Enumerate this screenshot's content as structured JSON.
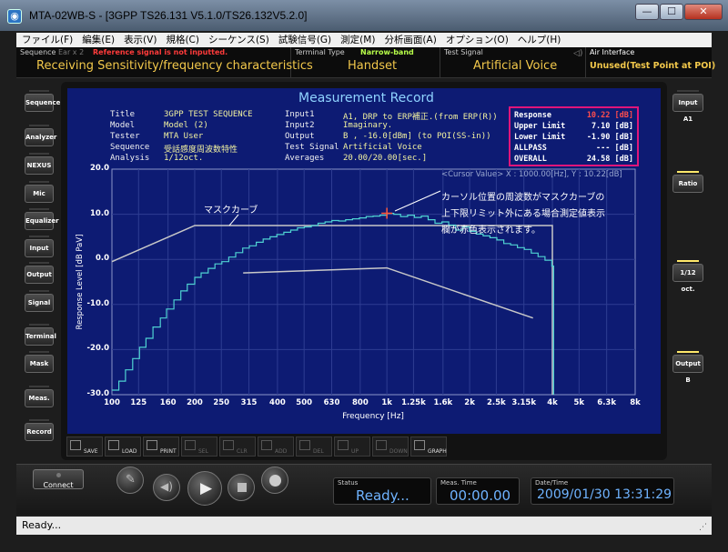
{
  "window": {
    "title": "MTA-02WB-S - [3GPP TS26.131 V5.1.0/TS26.132V5.2.0]"
  },
  "menu": [
    "ファイル(F)",
    "編集(E)",
    "表示(V)",
    "規格(C)",
    "シーケンス(S)",
    "試験信号(G)",
    "測定(M)",
    "分析画面(A)",
    "オプション(O)",
    "ヘルプ(H)"
  ],
  "infobar": {
    "sequence_label": "Sequence",
    "ear_label": "Ear x 2",
    "warning": "Reference signal is not inputted.",
    "sequence_value": "Receiving Sensitivity/frequency characteristics",
    "terminal_label": "Terminal Type",
    "narrowband": "Narrow-band",
    "terminal_value": "Handset",
    "signal_label": "Test Signal",
    "signal_value": "Artificial Voice",
    "air_label": "Air Interface",
    "air_value": "Unused(Test Point at POI)"
  },
  "left_buttons": [
    "Sequence",
    "Analyzer",
    "NEXUS",
    "Mic",
    "Equalizer",
    "Input",
    "Output",
    "Signal",
    "Terminal",
    "Mask",
    "Meas.",
    "Record"
  ],
  "right_buttons": [
    {
      "label": "Input A1",
      "lit": false
    },
    {
      "label": "Ratio",
      "lit": true
    },
    {
      "label": "1/12 oct.",
      "lit": true
    },
    {
      "label": "Output B",
      "lit": true
    }
  ],
  "record": {
    "title": "Measurement Record",
    "rows": [
      {
        "k1": "Title",
        "v1": "3GPP TEST SEQUENCE",
        "k2": "Input1",
        "v2": "A1, DRP to ERP補正.(from ERP(R))"
      },
      {
        "k1": "Model",
        "v1": "Model (2)",
        "k2": "Input2",
        "v2": "Imaginary."
      },
      {
        "k1": "Tester",
        "v1": "MTA User",
        "k2": "Output",
        "v2": "B , -16.0[dBm] (to POI(SS-in))"
      },
      {
        "k1": "Sequence",
        "v1": "受話感度周波数特性",
        "k2": "Test Signal",
        "v2": "Artificial Voice"
      },
      {
        "k1": "Analysis",
        "v1": "1/12oct.",
        "k2": "Averages",
        "v2": "20.00/20.00[sec.]"
      }
    ],
    "results": [
      {
        "label": "Response",
        "value": "10.22 [dB]",
        "color": "#ff4d4d"
      },
      {
        "label": "Upper Limit",
        "value": "7.10 [dB]",
        "color": "#ffffff"
      },
      {
        "label": "Lower Limit",
        "value": "-1.90 [dB]",
        "color": "#ffffff"
      },
      {
        "label": "ALLPASS",
        "value": "--- [dB]",
        "color": "#ffffff"
      },
      {
        "label": "OVERALL",
        "value": "24.58 [dB]",
        "color": "#ffffff"
      }
    ],
    "cursor_value": "<Cursor Value> X : 1000.00[Hz], Y : 10.22[dB]"
  },
  "annotations": {
    "mask_curve": "マスクカーブ",
    "note_lines": [
      "カーソル位置の周波数がマスクカーブの",
      "上下限リミット外にある場合測定値表示",
      "欄が赤色表示されます。"
    ]
  },
  "chart_data": {
    "type": "line",
    "xscale": "log",
    "xlabel": "Frequency [Hz]",
    "ylabel": "Response Level [dB PaV]",
    "xlim": [
      100,
      8000
    ],
    "ylim": [
      -30,
      20
    ],
    "x_ticks": [
      {
        "v": 100,
        "l": "100"
      },
      {
        "v": 125,
        "l": "125"
      },
      {
        "v": 160,
        "l": "160"
      },
      {
        "v": 200,
        "l": "200"
      },
      {
        "v": 250,
        "l": "250"
      },
      {
        "v": 315,
        "l": "315"
      },
      {
        "v": 400,
        "l": "400"
      },
      {
        "v": 500,
        "l": "500"
      },
      {
        "v": 630,
        "l": "630"
      },
      {
        "v": 800,
        "l": "800"
      },
      {
        "v": 1000,
        "l": "1k"
      },
      {
        "v": 1250,
        "l": "1.25k"
      },
      {
        "v": 1600,
        "l": "1.6k"
      },
      {
        "v": 2000,
        "l": "2k"
      },
      {
        "v": 2500,
        "l": "2.5k"
      },
      {
        "v": 3150,
        "l": "3.15k"
      },
      {
        "v": 4000,
        "l": "4k"
      },
      {
        "v": 5000,
        "l": "5k"
      },
      {
        "v": 6300,
        "l": "6.3k"
      },
      {
        "v": 8000,
        "l": "8k"
      }
    ],
    "y_ticks": [
      {
        "v": 20,
        "l": "20.0"
      },
      {
        "v": 10,
        "l": "10.0"
      },
      {
        "v": 0,
        "l": "0.0"
      },
      {
        "v": -10,
        "l": "-10.0"
      },
      {
        "v": -20,
        "l": "-20.0"
      },
      {
        "v": -30,
        "l": "-30.0"
      }
    ],
    "upper_mask": {
      "x": [
        100,
        200,
        4000,
        4000
      ],
      "y": [
        -0.5,
        7.5,
        7.5,
        -30
      ]
    },
    "lower_mask": {
      "x": [
        300,
        1000,
        3400
      ],
      "y": [
        -3,
        -1.9,
        -13
      ]
    },
    "measured": {
      "x": [
        100,
        106,
        112,
        119,
        126,
        133,
        141,
        150,
        158,
        168,
        178,
        188,
        200,
        211,
        224,
        237,
        251,
        266,
        282,
        299,
        316,
        335,
        355,
        376,
        398,
        422,
        447,
        473,
        501,
        531,
        562,
        596,
        631,
        668,
        708,
        750,
        794,
        841,
        891,
        944,
        1000,
        1059,
        1122,
        1189,
        1259,
        1334,
        1413,
        1496,
        1585,
        1679,
        1778,
        1884,
        1995,
        2113,
        2239,
        2371,
        2512,
        2661,
        2818,
        2985,
        3162,
        3350,
        3548,
        3758,
        3981
      ],
      "y": [
        -29,
        -27,
        -24.5,
        -22,
        -19.5,
        -17.5,
        -15,
        -13,
        -11,
        -9,
        -7,
        -5.5,
        -4,
        -3,
        -2,
        -1,
        -0.5,
        0.5,
        1.5,
        2.5,
        3,
        3.8,
        4.5,
        5,
        5.5,
        6,
        6.5,
        7,
        7.2,
        7.5,
        8,
        8.3,
        8.6,
        8.5,
        8.8,
        9,
        9.2,
        9.5,
        9.6,
        9.8,
        10.2,
        10.0,
        9.5,
        9.8,
        9.3,
        9.6,
        8.8,
        8,
        8.3,
        7.6,
        6.5,
        7.2,
        6.2,
        5.6,
        5.2,
        4.8,
        4.3,
        3.5,
        3.2,
        2.6,
        2.2,
        1.4,
        0.6,
        -0.2,
        -1.5
      ]
    },
    "cursor": {
      "x": 1000,
      "y": 10.22
    }
  },
  "toolbar": [
    {
      "label": "SAVE",
      "enabled": true
    },
    {
      "label": "LOAD",
      "enabled": true
    },
    {
      "label": "PRINT",
      "enabled": true
    },
    {
      "label": "SEL",
      "enabled": false
    },
    {
      "label": "CLR",
      "enabled": false
    },
    {
      "label": "ADD",
      "enabled": false
    },
    {
      "label": "DEL",
      "enabled": false
    },
    {
      "label": "UP",
      "enabled": false
    },
    {
      "label": "DOWN",
      "enabled": false
    },
    {
      "label": "GRAPH",
      "enabled": true
    }
  ],
  "bottom": {
    "connect": "Connect",
    "status_label": "Status",
    "status_value": "Ready...",
    "meas_label": "Meas. Time",
    "meas_value": "00:00.00",
    "date_label": "Date/Time",
    "date_value": "2009/01/30 13:31:29"
  },
  "statusbar": "Ready..."
}
